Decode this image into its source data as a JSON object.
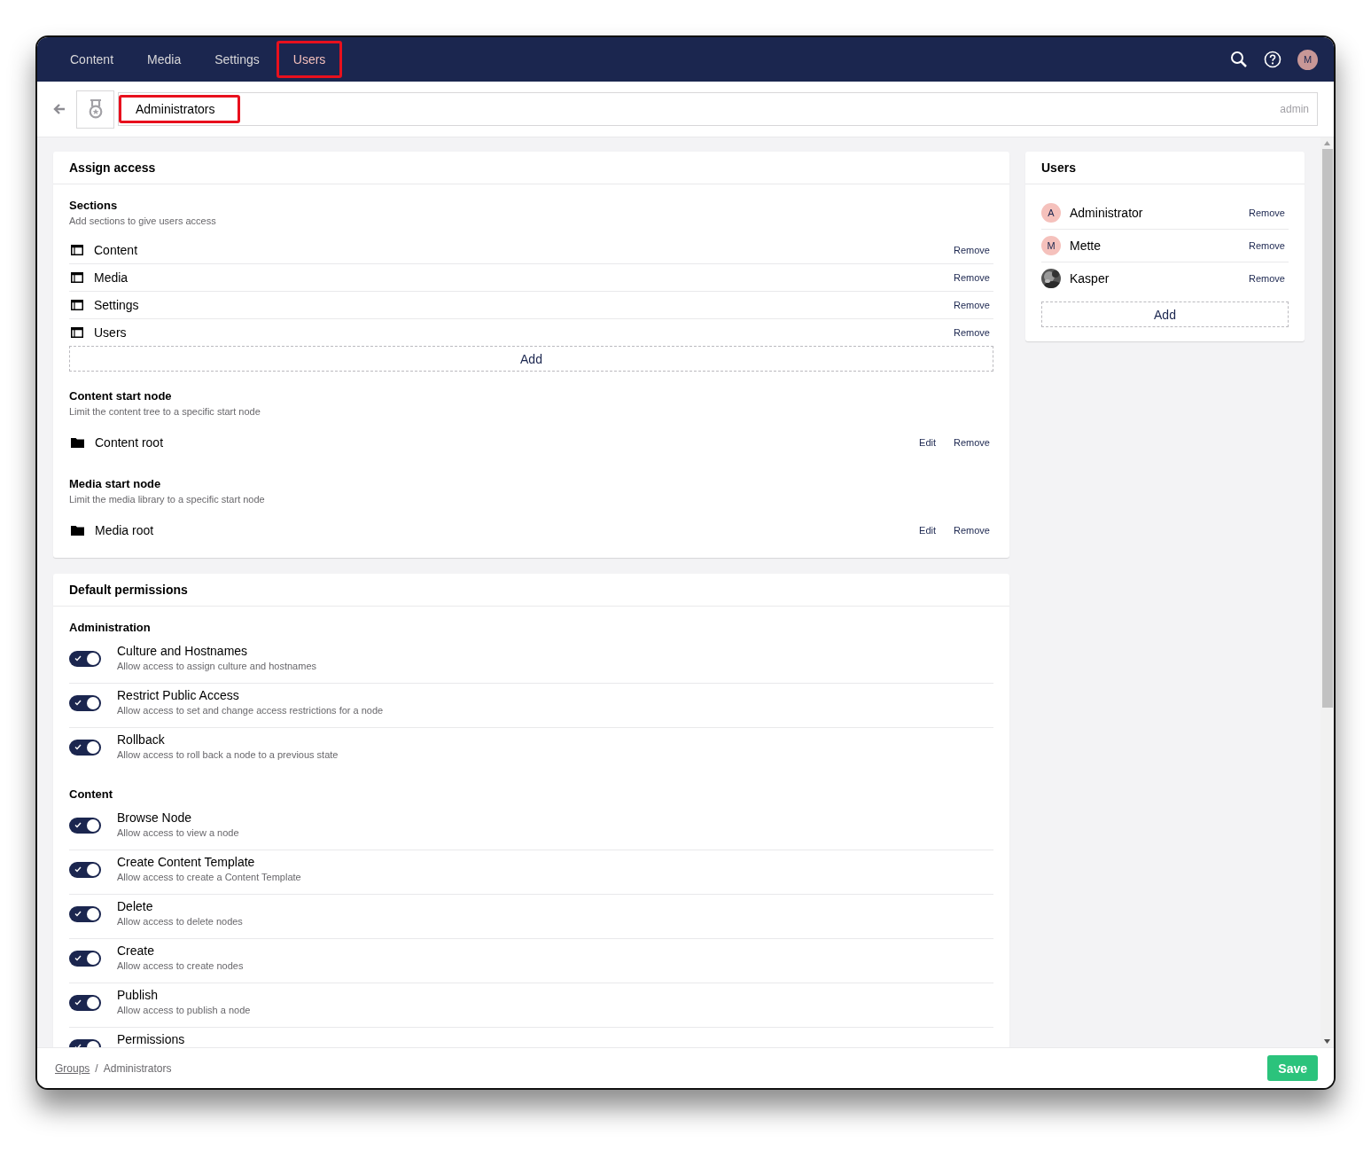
{
  "topbar": {
    "tabs": [
      {
        "label": "Content",
        "selected": false,
        "highlighted": false
      },
      {
        "label": "Media",
        "selected": false,
        "highlighted": false
      },
      {
        "label": "Settings",
        "selected": false,
        "highlighted": false
      },
      {
        "label": "Users",
        "selected": true,
        "highlighted": true
      }
    ],
    "avatar": "M"
  },
  "header": {
    "name": "Administrators",
    "name_highlighted": true,
    "alias": "admin"
  },
  "assign_access": {
    "title": "Assign access",
    "sections": {
      "title": "Sections",
      "description": "Add sections to give users access",
      "items": [
        {
          "label": "Content",
          "action": "Remove"
        },
        {
          "label": "Media",
          "action": "Remove"
        },
        {
          "label": "Settings",
          "action": "Remove"
        },
        {
          "label": "Users",
          "action": "Remove"
        }
      ],
      "add": "Add"
    },
    "start_nodes": [
      {
        "title": "Content start node",
        "description": "Limit the content tree to a specific start node",
        "node": "Content root",
        "actions": [
          "Edit",
          "Remove"
        ]
      },
      {
        "title": "Media start node",
        "description": "Limit the media library to a specific start node",
        "node": "Media root",
        "actions": [
          "Edit",
          "Remove"
        ]
      }
    ]
  },
  "default_permissions": {
    "title": "Default permissions",
    "groups": [
      {
        "title": "Administration",
        "items": [
          {
            "name": "Culture and Hostnames",
            "description": "Allow access to assign culture and hostnames",
            "on": true
          },
          {
            "name": "Restrict Public Access",
            "description": "Allow access to set and change access restrictions for a node",
            "on": true
          },
          {
            "name": "Rollback",
            "description": "Allow access to roll back a node to a previous state",
            "on": true
          }
        ]
      },
      {
        "title": "Content",
        "items": [
          {
            "name": "Browse Node",
            "description": "Allow access to view a node",
            "on": true
          },
          {
            "name": "Create Content Template",
            "description": "Allow access to create a Content Template",
            "on": true
          },
          {
            "name": "Delete",
            "description": "Allow access to delete nodes",
            "on": true
          },
          {
            "name": "Create",
            "description": "Allow access to create nodes",
            "on": true
          },
          {
            "name": "Publish",
            "description": "Allow access to publish a node",
            "on": true
          },
          {
            "name": "Permissions",
            "on": true
          }
        ]
      }
    ]
  },
  "users": {
    "title": "Users",
    "items": [
      {
        "name": "Administrator",
        "avatar": {
          "kind": "initial",
          "text": "A"
        },
        "action": "Remove"
      },
      {
        "name": "Mette",
        "avatar": {
          "kind": "initial",
          "text": "M"
        },
        "action": "Remove"
      },
      {
        "name": "Kasper",
        "action": "Remove"
      }
    ],
    "add": "Add"
  },
  "footer": {
    "breadcrumbs": [
      {
        "label": "Groups",
        "link": true
      },
      {
        "label": "Administrators",
        "link": false
      }
    ],
    "separator": "/",
    "save": "Save"
  }
}
